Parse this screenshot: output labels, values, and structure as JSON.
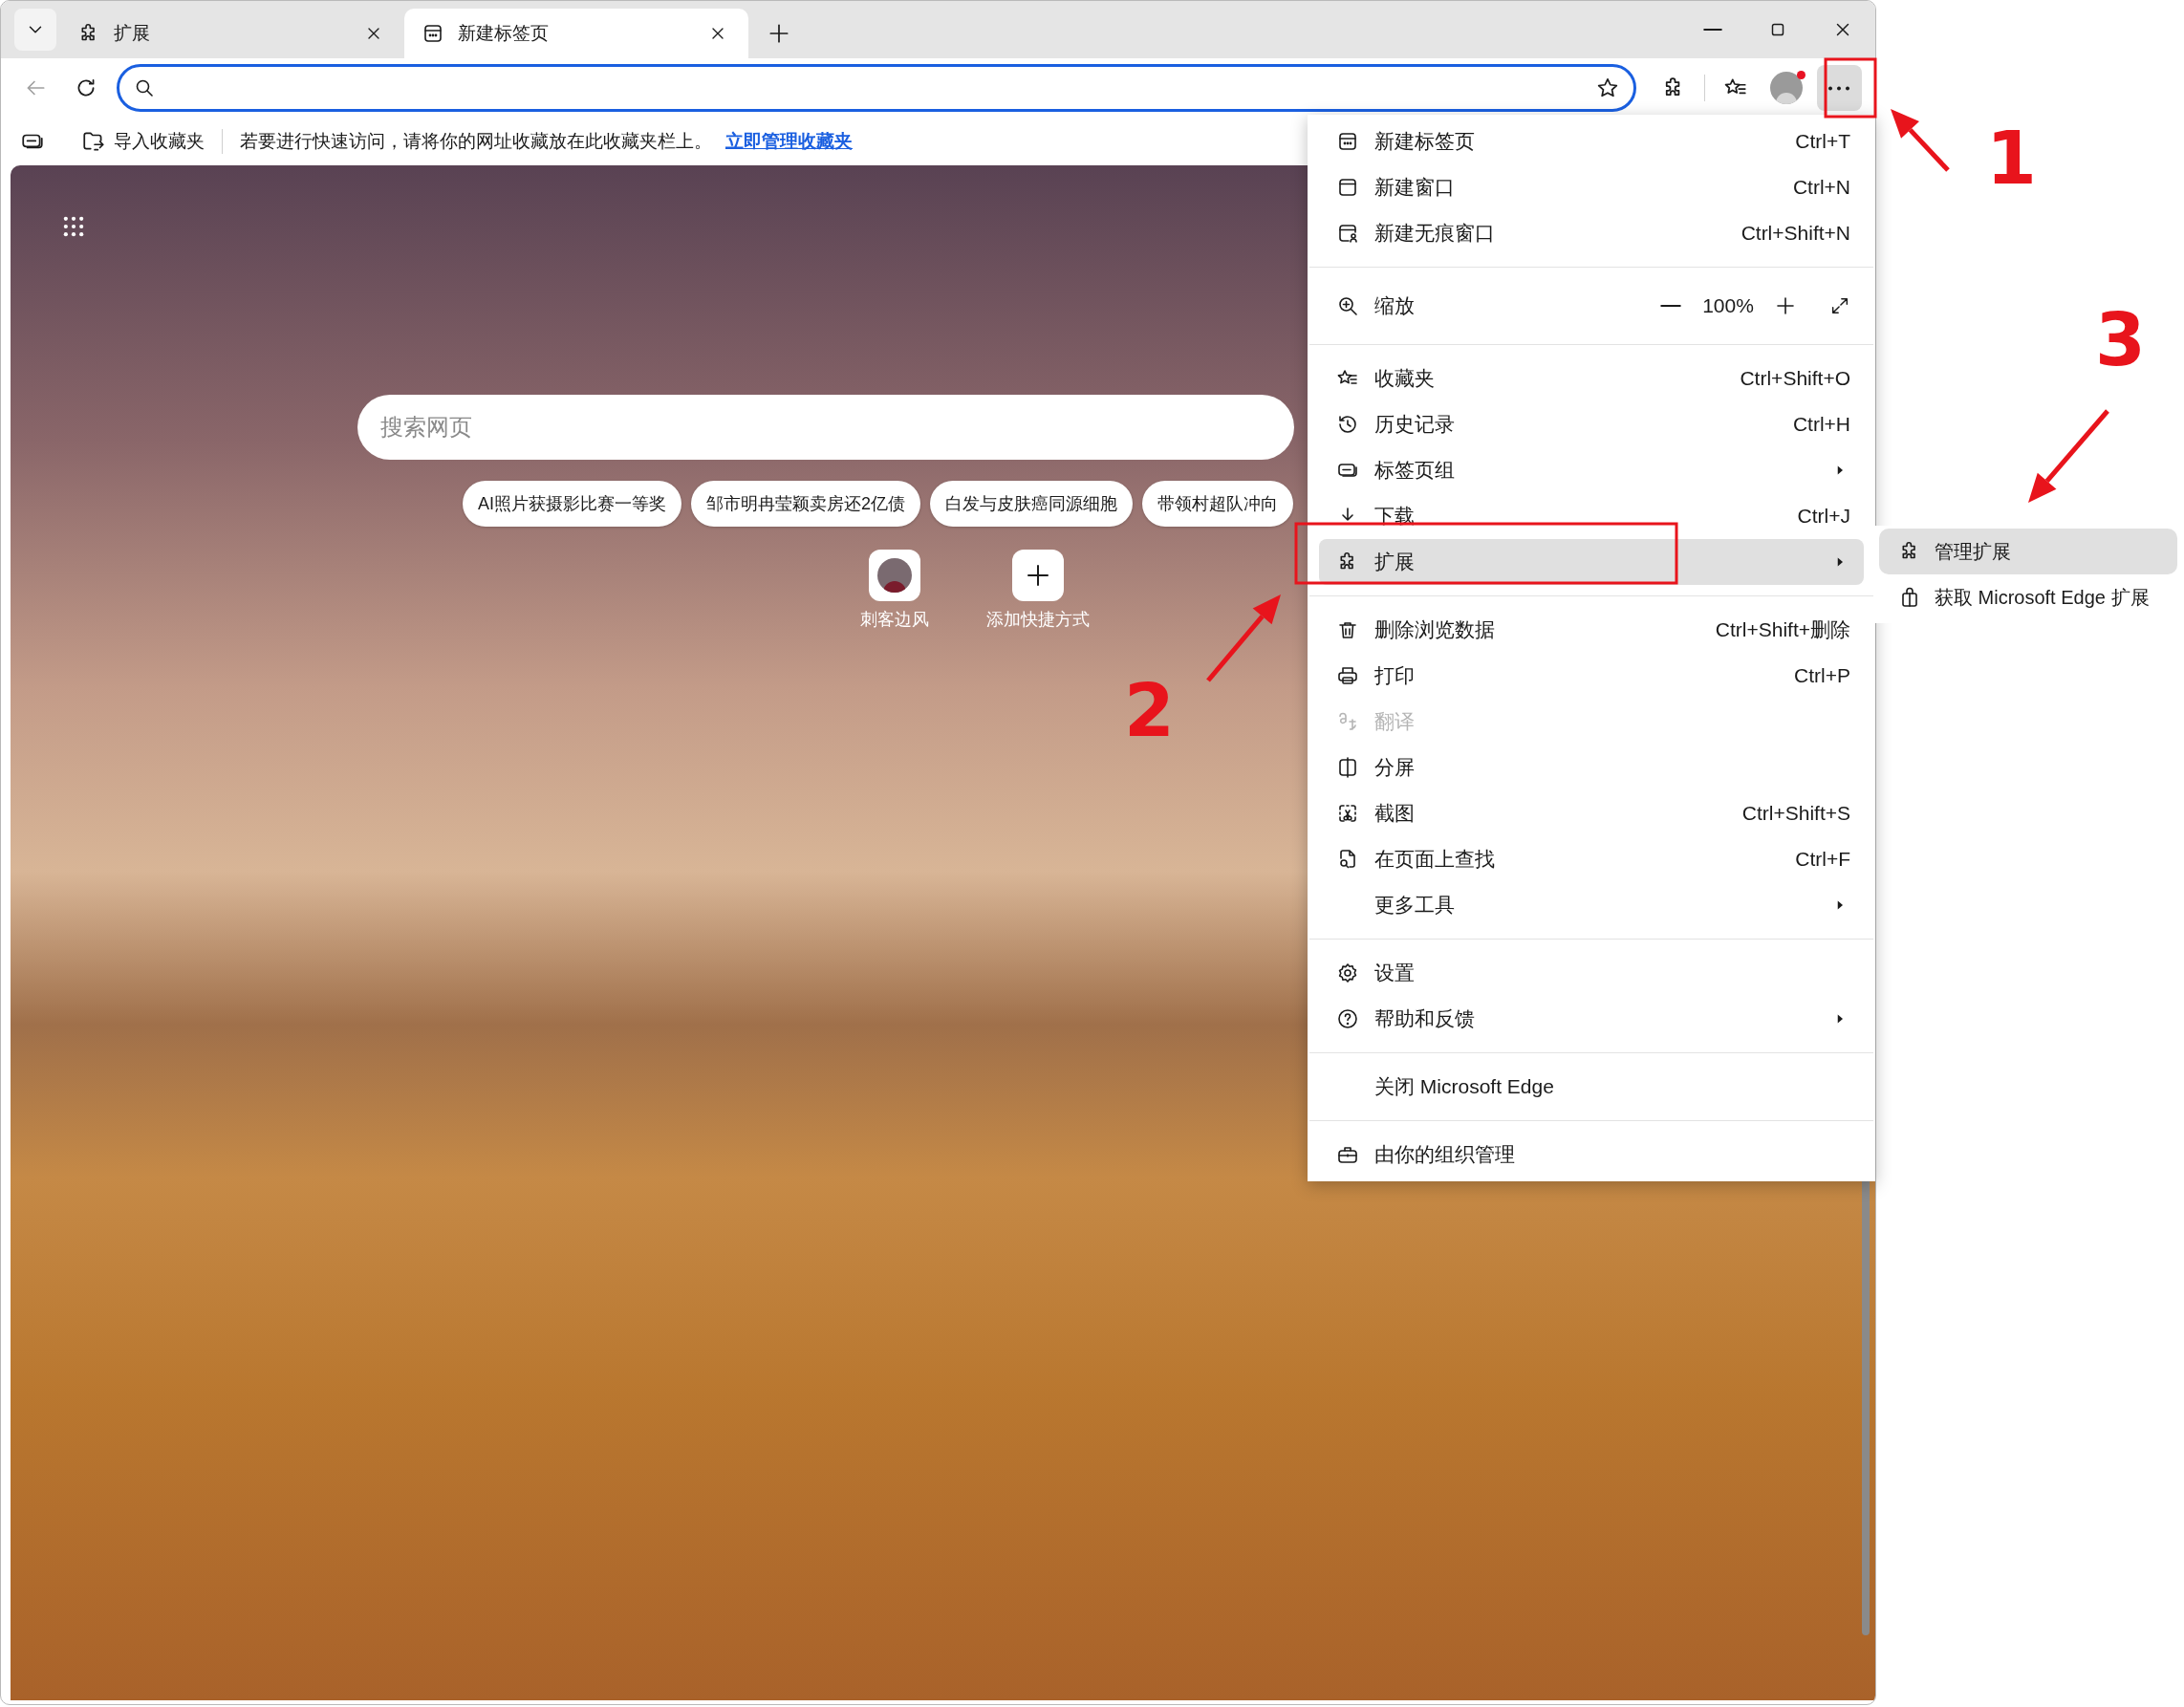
{
  "tabs": [
    {
      "label": "扩展",
      "selected": false
    },
    {
      "label": "新建标签页",
      "selected": true
    }
  ],
  "toolbar": {
    "profile_notification": true,
    "more_selected": true
  },
  "favorites_bar": {
    "import_label": "导入收藏夹",
    "message": "若要进行快速访问，请将你的网址收藏放在此收藏夹栏上。",
    "link": "立即管理收藏夹"
  },
  "new_tab_page": {
    "search_placeholder": "搜索网页",
    "trending": [
      "AI照片获摄影比赛一等奖",
      "邹市明冉莹颖卖房还2亿债",
      "白发与皮肤癌同源细胞",
      "带领村超队冲向"
    ],
    "shortcuts": [
      {
        "kind": "site",
        "label": "刺客边风"
      },
      {
        "kind": "add",
        "label": "添加快捷方式"
      }
    ]
  },
  "menu": {
    "items": [
      {
        "kind": "item",
        "label": "新建标签页",
        "shortcut": "Ctrl+T",
        "has_submenu": false,
        "disabled": false,
        "selected": false
      },
      {
        "kind": "item",
        "label": "新建窗口",
        "shortcut": "Ctrl+N",
        "has_submenu": false,
        "disabled": false,
        "selected": false
      },
      {
        "kind": "item",
        "label": "新建无痕窗口",
        "shortcut": "Ctrl+Shift+N",
        "has_submenu": false,
        "disabled": false,
        "selected": false
      },
      {
        "kind": "separator"
      },
      {
        "kind": "zoom",
        "label": "缩放",
        "value": "100%"
      },
      {
        "kind": "separator"
      },
      {
        "kind": "item",
        "label": "收藏夹",
        "shortcut": "Ctrl+Shift+O",
        "has_submenu": false,
        "disabled": false,
        "selected": false
      },
      {
        "kind": "item",
        "label": "历史记录",
        "shortcut": "Ctrl+H",
        "has_submenu": false,
        "disabled": false,
        "selected": false
      },
      {
        "kind": "item",
        "label": "标签页组",
        "has_submenu": true,
        "disabled": false,
        "selected": false
      },
      {
        "kind": "item",
        "label": "下载",
        "shortcut": "Ctrl+J",
        "has_submenu": false,
        "disabled": false,
        "selected": false
      },
      {
        "kind": "item",
        "label": "扩展",
        "has_submenu": true,
        "disabled": false,
        "selected": true
      },
      {
        "kind": "separator"
      },
      {
        "kind": "item",
        "label": "删除浏览数据",
        "shortcut": "Ctrl+Shift+删除",
        "has_submenu": false,
        "disabled": false,
        "selected": false
      },
      {
        "kind": "item",
        "label": "打印",
        "shortcut": "Ctrl+P",
        "has_submenu": false,
        "disabled": false,
        "selected": false
      },
      {
        "kind": "item",
        "label": "翻译",
        "has_submenu": false,
        "disabled": true,
        "selected": false
      },
      {
        "kind": "item",
        "label": "分屏",
        "has_submenu": false,
        "disabled": false,
        "selected": false
      },
      {
        "kind": "item",
        "label": "截图",
        "shortcut": "Ctrl+Shift+S",
        "has_submenu": false,
        "disabled": false,
        "selected": false
      },
      {
        "kind": "item",
        "label": "在页面上查找",
        "shortcut": "Ctrl+F",
        "has_submenu": false,
        "disabled": false,
        "selected": false
      },
      {
        "kind": "item",
        "label": "更多工具",
        "has_submenu": true,
        "disabled": false,
        "selected": false
      },
      {
        "kind": "separator"
      },
      {
        "kind": "item",
        "label": "设置",
        "has_submenu": false,
        "disabled": false,
        "selected": false
      },
      {
        "kind": "item",
        "label": "帮助和反馈",
        "has_submenu": true,
        "disabled": false,
        "selected": false
      },
      {
        "kind": "separator"
      },
      {
        "kind": "item",
        "label": "关闭 Microsoft Edge",
        "has_submenu": false,
        "disabled": false,
        "selected": false
      },
      {
        "kind": "separator"
      },
      {
        "kind": "item",
        "label": "由你的组织管理",
        "has_submenu": false,
        "disabled": false,
        "selected": false
      }
    ]
  },
  "submenu": {
    "items": [
      {
        "label": "管理扩展",
        "selected": true
      },
      {
        "label": "获取 Microsoft Edge 扩展",
        "selected": false
      }
    ]
  },
  "annotations": [
    {
      "label": "1"
    },
    {
      "label": "2"
    },
    {
      "label": "3"
    }
  ]
}
